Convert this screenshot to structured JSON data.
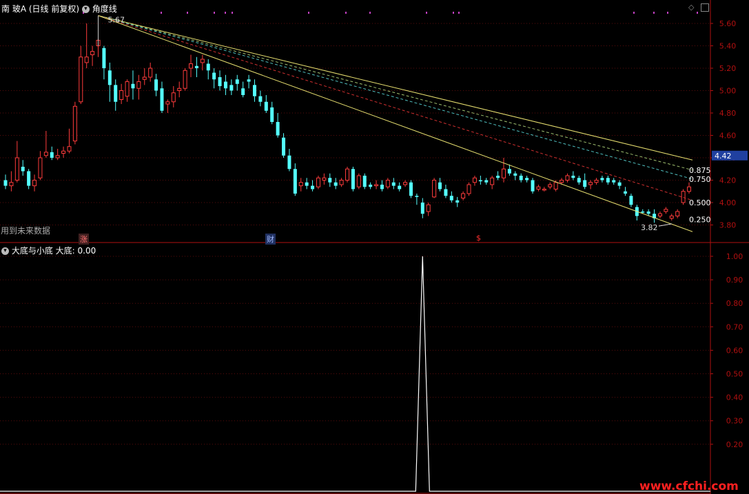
{
  "top_header": {
    "stock_name": "南 玻A",
    "period": "(日线 前复权)",
    "indicator": "角度线"
  },
  "bottom_header": {
    "indicator": "大底与小底",
    "series_label": "大底: 0.00"
  },
  "future_data_note": "用到未来数据",
  "event_tags": [
    {
      "text": "涨",
      "color": "#c06060"
    },
    {
      "text": "财",
      "color": "#6080ff"
    },
    {
      "text": "$",
      "color": "#ff3030"
    }
  ],
  "watermark": "www.cfchi.com",
  "colors": {
    "frame": "#b01010",
    "up": "#ff3c3c",
    "down": "#54ffff",
    "angle_main": "#e8e070",
    "watermark": "#ff2020"
  },
  "chart_data": [
    {
      "type": "candlestick",
      "title": "角度线",
      "ylim": [
        3.7,
        5.7
      ],
      "y_ticks": [
        "5.60",
        "5.40",
        "5.20",
        "5.00",
        "4.80",
        "4.60",
        "4.40",
        "4.20",
        "4.00",
        "3.80"
      ],
      "current_price": "4.42",
      "high_label": "5.67",
      "low_label": "3.82",
      "angle_levels": [
        "0.875",
        "0.750",
        "0.500",
        "0.250"
      ],
      "angle_lines": [
        {
          "level": "1.000",
          "start": 5.67,
          "end": 4.38,
          "color": "#e8e070",
          "dash": false
        },
        {
          "level": "0.875",
          "start": 5.67,
          "end": 4.29,
          "color": "#a0c070",
          "dash": true
        },
        {
          "level": "0.750",
          "start": 5.67,
          "end": 4.21,
          "color": "#50c0c0",
          "dash": true
        },
        {
          "level": "0.500",
          "start": 5.67,
          "end": 4.02,
          "color": "#d03030",
          "dash": true
        },
        {
          "level": "0.000",
          "start": 5.67,
          "end": 3.74,
          "color": "#e8e070",
          "dash": false
        }
      ],
      "candles": [
        [
          4.2,
          4.25,
          4.15,
          4.12
        ],
        [
          4.15,
          4.28,
          4.18,
          4.1
        ],
        [
          4.2,
          4.55,
          4.4,
          4.18
        ],
        [
          4.32,
          4.38,
          4.28,
          4.24
        ],
        [
          4.28,
          4.3,
          4.15,
          4.12
        ],
        [
          4.15,
          4.25,
          4.2,
          4.1
        ],
        [
          4.22,
          4.46,
          4.4,
          4.2
        ],
        [
          4.42,
          4.64,
          4.45,
          4.4
        ],
        [
          4.45,
          4.5,
          4.4,
          4.38
        ],
        [
          4.4,
          4.48,
          4.42,
          4.38
        ],
        [
          4.44,
          4.5,
          4.46,
          4.4
        ],
        [
          4.46,
          4.66,
          4.5,
          4.44
        ],
        [
          4.55,
          4.9,
          4.86,
          4.52
        ],
        [
          4.9,
          5.4,
          5.3,
          4.88
        ],
        [
          5.25,
          5.6,
          5.3,
          5.2
        ],
        [
          5.32,
          5.4,
          5.35,
          5.22
        ],
        [
          5.4,
          5.67,
          5.45,
          5.3
        ],
        [
          5.38,
          5.4,
          5.2,
          5.1
        ],
        [
          5.18,
          5.25,
          5.05,
          4.9
        ],
        [
          5.05,
          5.1,
          4.9,
          4.82
        ],
        [
          4.92,
          5.06,
          5.0,
          4.88
        ],
        [
          4.95,
          5.1,
          5.08,
          4.9
        ],
        [
          5.06,
          5.18,
          5.02,
          4.92
        ],
        [
          5.02,
          5.14,
          5.08,
          4.92
        ],
        [
          5.1,
          5.2,
          5.12,
          5.05
        ],
        [
          5.12,
          5.25,
          5.2,
          5.08
        ],
        [
          5.1,
          5.15,
          5.0,
          4.95
        ],
        [
          5.02,
          5.08,
          4.82,
          4.8
        ],
        [
          4.88,
          4.92,
          4.9,
          4.8
        ],
        [
          4.9,
          5.04,
          4.98,
          4.85
        ],
        [
          5.0,
          5.08,
          5.02,
          4.94
        ],
        [
          5.02,
          5.2,
          5.18,
          5.0
        ],
        [
          5.2,
          5.32,
          5.24,
          5.12
        ],
        [
          5.22,
          5.3,
          5.2,
          5.12
        ],
        [
          5.25,
          5.32,
          5.28,
          5.18
        ],
        [
          5.24,
          5.28,
          5.18,
          5.1
        ],
        [
          5.16,
          5.2,
          5.1,
          5.02
        ],
        [
          5.12,
          5.18,
          5.04,
          5.0
        ],
        [
          5.08,
          5.14,
          5.02,
          4.96
        ],
        [
          5.05,
          5.1,
          5.0,
          4.96
        ],
        [
          5.1,
          5.14,
          5.06,
          5.0
        ],
        [
          5.02,
          5.08,
          4.96,
          4.94
        ],
        [
          5.1,
          5.14,
          5.08,
          5.02
        ],
        [
          5.05,
          5.1,
          4.95,
          4.9
        ],
        [
          4.95,
          5.0,
          4.9,
          4.86
        ],
        [
          4.9,
          4.96,
          4.82,
          4.8
        ],
        [
          4.85,
          4.9,
          4.72,
          4.7
        ],
        [
          4.72,
          4.8,
          4.6,
          4.58
        ],
        [
          4.58,
          4.62,
          4.42,
          4.4
        ],
        [
          4.42,
          4.48,
          4.3,
          4.28
        ],
        [
          4.3,
          4.35,
          4.08,
          4.06
        ],
        [
          4.15,
          4.22,
          4.18,
          4.1
        ],
        [
          4.18,
          4.22,
          4.15,
          4.12
        ],
        [
          4.15,
          4.2,
          4.12,
          4.1
        ],
        [
          4.14,
          4.24,
          4.22,
          4.12
        ],
        [
          4.2,
          4.26,
          4.22,
          4.16
        ],
        [
          4.22,
          4.26,
          4.18,
          4.14
        ],
        [
          4.18,
          4.22,
          4.15,
          4.12
        ],
        [
          4.16,
          4.22,
          4.2,
          4.14
        ],
        [
          4.2,
          4.32,
          4.3,
          4.18
        ],
        [
          4.3,
          4.32,
          4.12,
          4.1
        ],
        [
          4.14,
          4.26,
          4.24,
          4.12
        ],
        [
          4.24,
          4.26,
          4.14,
          4.12
        ],
        [
          4.16,
          4.18,
          4.14,
          4.12
        ],
        [
          4.15,
          4.2,
          4.16,
          4.12
        ],
        [
          4.16,
          4.2,
          4.12,
          4.1
        ],
        [
          4.14,
          4.22,
          4.2,
          4.12
        ],
        [
          4.18,
          4.22,
          4.15,
          4.12
        ],
        [
          4.15,
          4.18,
          4.12,
          4.1
        ],
        [
          4.16,
          4.2,
          4.18,
          4.14
        ],
        [
          4.18,
          4.2,
          4.06,
          4.04
        ],
        [
          4.06,
          4.08,
          4.05,
          3.98
        ],
        [
          4.0,
          4.04,
          3.9,
          3.86
        ],
        [
          3.92,
          4.0,
          3.98,
          3.88
        ],
        [
          4.05,
          4.22,
          4.2,
          4.04
        ],
        [
          4.18,
          4.22,
          4.12,
          4.1
        ],
        [
          4.12,
          4.16,
          4.06,
          4.04
        ],
        [
          4.06,
          4.1,
          4.02,
          4.0
        ],
        [
          4.02,
          4.05,
          4.0,
          3.96
        ],
        [
          4.04,
          4.1,
          4.08,
          4.02
        ],
        [
          4.08,
          4.18,
          4.16,
          4.06
        ],
        [
          4.18,
          4.24,
          4.22,
          4.15
        ],
        [
          4.2,
          4.24,
          4.19,
          4.16
        ],
        [
          4.2,
          4.22,
          4.18,
          4.16
        ],
        [
          4.16,
          4.24,
          4.22,
          4.12
        ],
        [
          4.24,
          4.28,
          4.22,
          4.2
        ],
        [
          4.22,
          4.4,
          4.3,
          4.18
        ],
        [
          4.3,
          4.34,
          4.26,
          4.24
        ],
        [
          4.26,
          4.28,
          4.24,
          4.2
        ],
        [
          4.24,
          4.26,
          4.2,
          4.18
        ],
        [
          4.22,
          4.24,
          4.2,
          4.18
        ],
        [
          4.2,
          4.22,
          4.1,
          4.08
        ],
        [
          4.12,
          4.16,
          4.14,
          4.1
        ],
        [
          4.12,
          4.14,
          4.12,
          4.1
        ],
        [
          4.14,
          4.18,
          4.16,
          4.12
        ],
        [
          4.12,
          4.2,
          4.18,
          4.1
        ],
        [
          4.18,
          4.22,
          4.2,
          4.16
        ],
        [
          4.2,
          4.26,
          4.24,
          4.18
        ],
        [
          4.24,
          4.28,
          4.22,
          4.2
        ],
        [
          4.22,
          4.24,
          4.18,
          4.16
        ],
        [
          4.2,
          4.26,
          4.14,
          4.12
        ],
        [
          4.16,
          4.2,
          4.18,
          4.12
        ],
        [
          4.18,
          4.22,
          4.2,
          4.16
        ],
        [
          4.22,
          4.24,
          4.2,
          4.18
        ],
        [
          4.22,
          4.24,
          4.18,
          4.16
        ],
        [
          4.2,
          4.22,
          4.18,
          4.16
        ],
        [
          4.18,
          4.2,
          4.15,
          4.12
        ],
        [
          4.1,
          4.14,
          4.08,
          4.06
        ],
        [
          4.06,
          4.08,
          3.98,
          3.96
        ],
        [
          3.96,
          3.98,
          3.88,
          3.84
        ],
        [
          3.92,
          3.94,
          3.91,
          3.9
        ],
        [
          3.92,
          3.94,
          3.9,
          3.88
        ],
        [
          3.9,
          3.94,
          3.86,
          3.82
        ],
        [
          3.88,
          3.92,
          3.9,
          3.86
        ],
        [
          3.92,
          3.96,
          3.94,
          3.9
        ],
        [
          3.86,
          3.9,
          3.88,
          3.84
        ],
        [
          3.88,
          3.94,
          3.92,
          3.86
        ],
        [
          4.0,
          4.12,
          4.1,
          3.98
        ],
        [
          4.1,
          4.18,
          4.14,
          4.08
        ]
      ]
    },
    {
      "type": "line",
      "title": "大底与小底",
      "ylim": [
        0,
        1.05
      ],
      "y_ticks": [
        "1.00",
        "0.90",
        "0.80",
        "0.70",
        "0.60",
        "0.50",
        "0.40",
        "0.30",
        "0.20"
      ],
      "series": [
        {
          "name": "大底",
          "spike_at_index": 72,
          "spike_value": 1.0
        }
      ]
    }
  ]
}
